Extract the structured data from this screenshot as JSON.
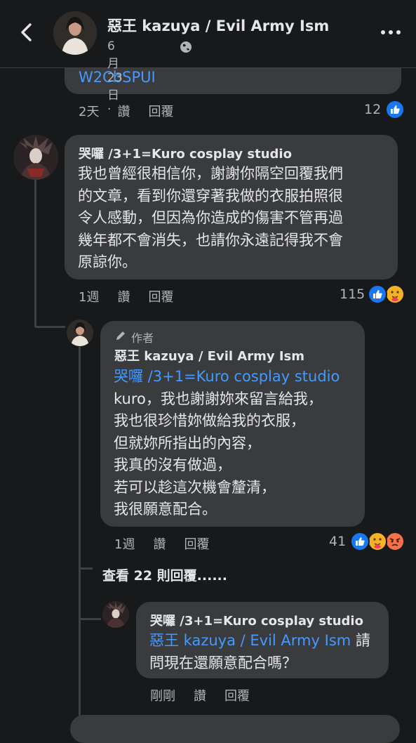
{
  "header": {
    "title": "惡王 kazuya / Evil Army Ism",
    "date": "6月23日 ·"
  },
  "c0": {
    "link_text": "W2CbSPUI",
    "time": "2天",
    "like": "讚",
    "reply": "回覆",
    "count": "12"
  },
  "c1": {
    "name": "哭囉 /3+1=Kuro cosplay studio",
    "lines": [
      "我也曾經很相信你，謝謝你隔空回覆我們",
      "的文章，看到你還穿著我做的衣服拍照很",
      "令人感動，但因為你造成的傷害不管再過",
      "幾年都不會消失，也請你永遠記得我不會",
      "原諒你。"
    ],
    "time": "1週",
    "like": "讚",
    "reply": "回覆",
    "count": "115"
  },
  "c2": {
    "author_badge": "作者",
    "name": "惡王 kazuya / Evil Army Ism",
    "mention": "哭囉 /3+1=Kuro cosplay studio",
    "lines": [
      "kuro，我也謝謝妳來留言給我，",
      "我也很珍惜妳做給我的衣服，",
      "但就妳所指出的內容，",
      "我真的沒有做過，",
      "若可以趁這次機會釐清，",
      "我很願意配合。"
    ],
    "time": "1週",
    "like": "讚",
    "reply": "回覆",
    "count": "41"
  },
  "view_more": "查看 22 則回覆......",
  "c3": {
    "name": "哭囉 /3+1=Kuro cosplay studio",
    "mention": "惡王 kazuya / Evil Army Ism",
    "text_after": " 請",
    "line2": "問現在還願意配合嗎？",
    "time": "剛剛",
    "like": "讚",
    "reply": "回覆"
  },
  "colors": {
    "background": "#18191a",
    "bubble": "#3a3b3c",
    "link": "#4599ff",
    "like_blue": "#1877f2",
    "angry": "#f7714a",
    "care": "#f7b125"
  },
  "icons": [
    "back-arrow-icon",
    "globe-icon",
    "more-icon",
    "like-reaction-icon",
    "care-reaction-icon",
    "angry-reaction-icon",
    "pencil-icon"
  ]
}
